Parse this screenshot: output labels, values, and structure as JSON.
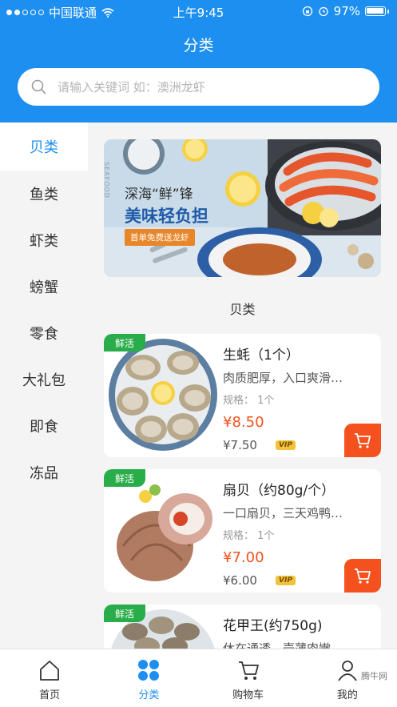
{
  "status_bar": {
    "carrier": "中国联通",
    "time": "上午9:45",
    "battery": "97%"
  },
  "header": {
    "title": "分类"
  },
  "search": {
    "placeholder": "请输入关键词 如：澳洲龙虾"
  },
  "sidebar": {
    "items": [
      {
        "label": "贝类",
        "active": true
      },
      {
        "label": "鱼类"
      },
      {
        "label": "虾类"
      },
      {
        "label": "螃蟹"
      },
      {
        "label": "零食"
      },
      {
        "label": "大礼包"
      },
      {
        "label": "即食"
      },
      {
        "label": "冻品"
      }
    ]
  },
  "banner": {
    "line1": "深海“鲜”锋",
    "line2": "美味轻负担",
    "tag": "首单免费送龙虾",
    "side_text": "SEAFOOD"
  },
  "section": {
    "title": "贝类"
  },
  "products": [
    {
      "badge": "鲜活",
      "name": "生蚝（1个）",
      "desc": "肉质肥厚，入口爽滑…",
      "spec": "规格：  1个",
      "price": "¥8.50",
      "vip_price": "¥7.50",
      "vip_label": "VIP"
    },
    {
      "badge": "鲜活",
      "name": "扇贝（约80g/个）",
      "desc": "一口扇贝，三天鸡鸭…",
      "spec": "规格：  1个",
      "price": "¥7.00",
      "vip_price": "¥6.00",
      "vip_label": "VIP"
    },
    {
      "badge": "鲜活",
      "name": "花甲王(约750g)",
      "desc": "休在通透，壳薄肉嫩"
    }
  ],
  "tabbar": {
    "items": [
      {
        "label": "首页",
        "icon": "home-icon"
      },
      {
        "label": "分类",
        "icon": "category-icon",
        "active": true
      },
      {
        "label": "购物车",
        "icon": "cart-icon"
      },
      {
        "label": "我的",
        "icon": "user-icon"
      }
    ]
  },
  "watermark": "腾牛网",
  "colors": {
    "primary": "#1d8ff0",
    "price": "#f4511e",
    "fresh_badge": "#29ad4a",
    "vip": "#f0c33a"
  }
}
